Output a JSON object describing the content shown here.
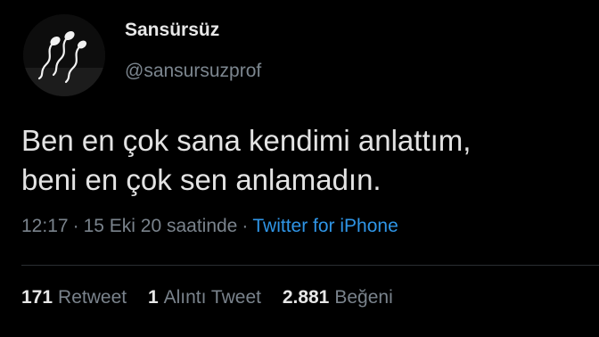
{
  "author": {
    "display_name": "Sansürsüz",
    "handle": "@sansursuzprof",
    "avatar_icon": "sperm-illustration-avatar"
  },
  "tweet": {
    "lines": [
      "Ben en çok sana kendimi anlattım,",
      "beni en çok sen anlamadın."
    ]
  },
  "meta": {
    "time": "12:17",
    "date": "15 Eki 20 saatinde",
    "separator": "·",
    "source": "Twitter for iPhone"
  },
  "stats": {
    "retweets": {
      "count": "171",
      "label": "Retweet"
    },
    "quotes": {
      "count": "1",
      "label": "Alıntı Tweet"
    },
    "likes": {
      "count": "2.881",
      "label": "Beğeni"
    }
  },
  "colors": {
    "background": "#000000",
    "link": "#2f95e6",
    "secondary_text": "#7a838c"
  }
}
